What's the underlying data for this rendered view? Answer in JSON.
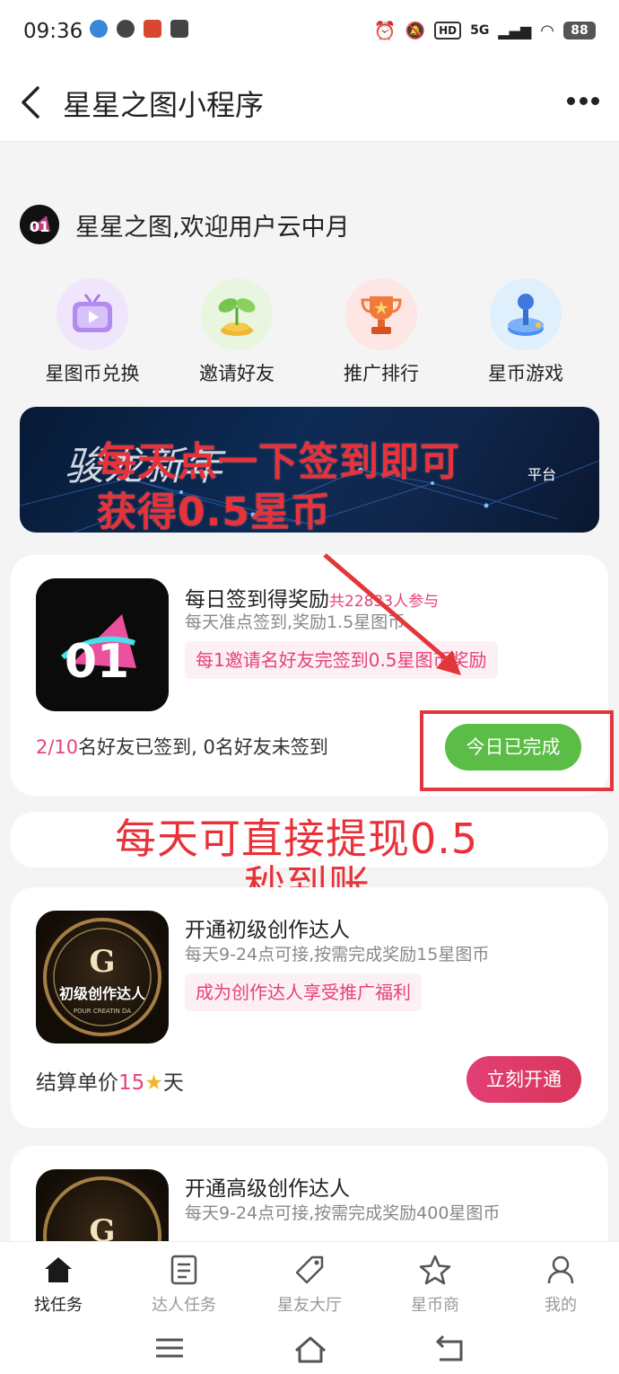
{
  "status_bar": {
    "time": "09:36",
    "hd": "HD",
    "network": "5G",
    "battery": "88"
  },
  "nav": {
    "title": "星星之图小程序",
    "back_icon": "back-arrow-icon",
    "more_icon": "more-dots-icon"
  },
  "welcome": {
    "text": "星星之图,欢迎用户云中月",
    "logo_text": "01"
  },
  "quick_actions": [
    {
      "label": "星图币兑换",
      "icon": "tv-play-icon"
    },
    {
      "label": "邀请好友",
      "icon": "sprout-coins-icon"
    },
    {
      "label": "推广排行",
      "icon": "trophy-icon"
    },
    {
      "label": "星币游戏",
      "icon": "joystick-icon"
    }
  ],
  "banner": {
    "script_text": "骏龙新年",
    "small_text": "平台"
  },
  "annotations": {
    "top_line1": "每天点一下签到即可",
    "top_line2": "获得0.5星币",
    "mid_line1": "每天可直接提现0.5",
    "mid_line2": "秒到账"
  },
  "cards": [
    {
      "title": "每日签到得奖励",
      "participants": "共22833人参与",
      "desc": "每天准点签到,奖励1.5星图币",
      "tag": "每1邀请名好友完签到0.5星图币奖励",
      "foot_accent": "2/10",
      "foot_rest": "名好友已签到, 0名好友未签到",
      "button": "今日已完成",
      "thumb_text": "01"
    },
    {
      "title": "开通初级创作达人",
      "desc": "每天9-24点可接,按需完成奖励15星图币",
      "tag": "成为创作达人享受推广福利",
      "foot_prefix": "结算单价",
      "foot_accent": "15",
      "foot_suffix": "天",
      "button": "立刻开通",
      "thumb_title": "初级创作达人",
      "thumb_sub": "POUR CREATIN DA"
    },
    {
      "title": "开通高级创作达人",
      "desc": "每天9-24点可接,按需完成奖励400星图币"
    }
  ],
  "tabbar": [
    {
      "label": "找任务",
      "icon": "home-icon",
      "active": true
    },
    {
      "label": "达人任务",
      "icon": "task-list-icon",
      "active": false
    },
    {
      "label": "星友大厅",
      "icon": "tag-icon",
      "active": false
    },
    {
      "label": "星币商",
      "icon": "star-icon",
      "active": false
    },
    {
      "label": "我的",
      "icon": "user-icon",
      "active": false
    }
  ],
  "colors": {
    "accent_pink": "#e5437c",
    "done_green": "#5bbd45",
    "annotation_red": "#e8323a"
  }
}
